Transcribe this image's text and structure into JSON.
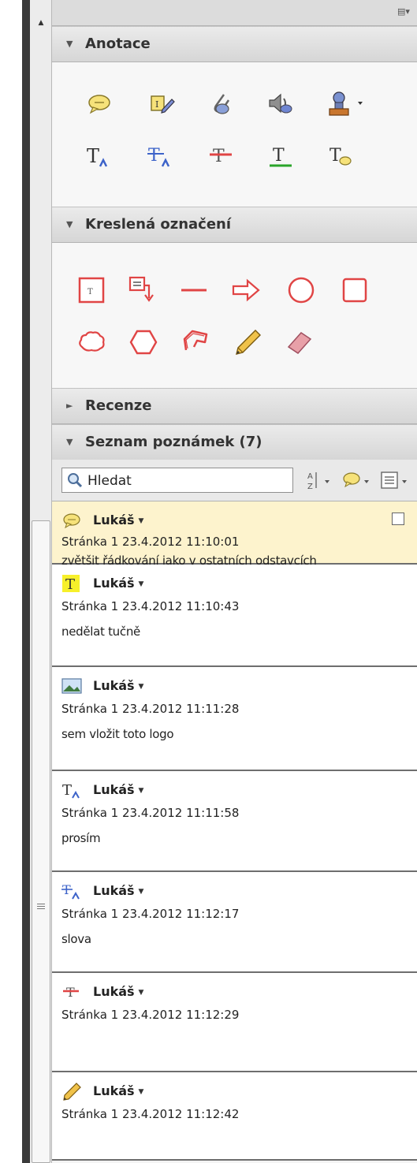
{
  "colors": {
    "selected_item_bg": "#fdf3cd",
    "header_bg": "#dcdcdc",
    "strike_red": "#e04545",
    "underline_green": "#2aa52a",
    "annotation_blue": "#3d63c9"
  },
  "sections": {
    "annotations": {
      "label": "Anotace",
      "expanded": true
    },
    "drawing": {
      "label": "Kreslená označení",
      "expanded": true
    },
    "review": {
      "label": "Recenze",
      "expanded": false
    },
    "comment_list": {
      "label": "Seznam poznámek (7)",
      "expanded": true
    }
  },
  "annotation_tools": [
    "sticky-note-icon",
    "highlight-text-icon",
    "attach-file-icon",
    "record-audio-icon",
    "stamp-icon",
    "insert-text-icon",
    "replace-text-icon",
    "strikethrough-icon",
    "underline-icon",
    "text-note-icon"
  ],
  "drawing_tools": [
    "text-box-icon",
    "callout-icon",
    "line-icon",
    "arrow-icon",
    "oval-icon",
    "rectangle-icon",
    "cloud-icon",
    "polygon-icon",
    "polyline-icon",
    "pencil-icon",
    "eraser-icon"
  ],
  "search": {
    "placeholder": "Hledat"
  },
  "comments": [
    {
      "icon": "sticky-note-icon",
      "author": "Lukáš",
      "meta": "Stránka 1  23.4.2012 11:10:01",
      "text": "zvětšit řádkování jako v ostatních odstavcích",
      "selected": true
    },
    {
      "icon": "highlight-t-icon",
      "author": "Lukáš",
      "meta": "Stránka 1  23.4.2012 11:10:43",
      "text": "nedělat tučně",
      "selected": false
    },
    {
      "icon": "image-icon",
      "author": "Lukáš",
      "meta": "Stránka 1  23.4.2012 11:11:28",
      "text": "sem vložit toto logo",
      "selected": false
    },
    {
      "icon": "insert-text-icon",
      "author": "Lukáš",
      "meta": "Stránka 1  23.4.2012 11:11:58",
      "text": "prosím",
      "selected": false
    },
    {
      "icon": "replace-text-icon",
      "author": "Lukáš",
      "meta": "Stránka 1  23.4.2012 11:12:17",
      "text": "slova",
      "selected": false
    },
    {
      "icon": "strikethrough-icon",
      "author": "Lukáš",
      "meta": "Stránka 1  23.4.2012 11:12:29",
      "text": "",
      "selected": false
    },
    {
      "icon": "pencil-icon",
      "author": "Lukáš",
      "meta": "Stránka 1  23.4.2012 11:12:42",
      "text": "",
      "selected": false
    }
  ]
}
